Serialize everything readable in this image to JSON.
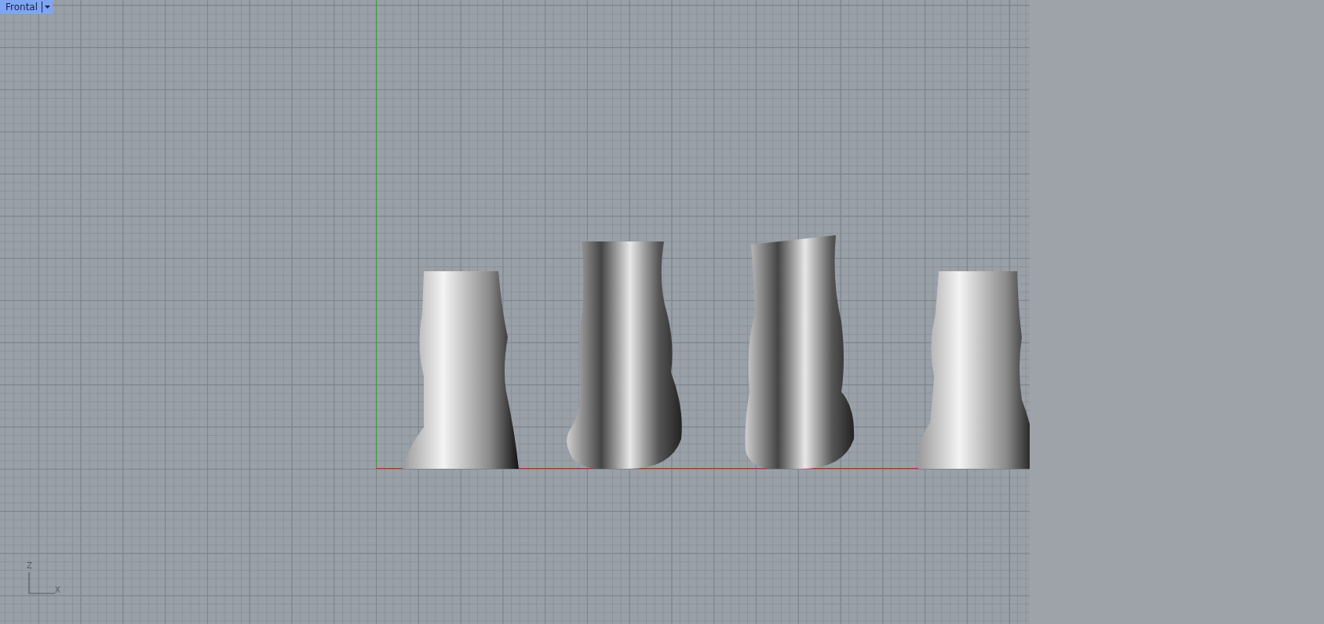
{
  "viewport": {
    "title": "Frontal",
    "axis_icon": {
      "vertical_label": "Z",
      "horizontal_label": "X"
    }
  }
}
